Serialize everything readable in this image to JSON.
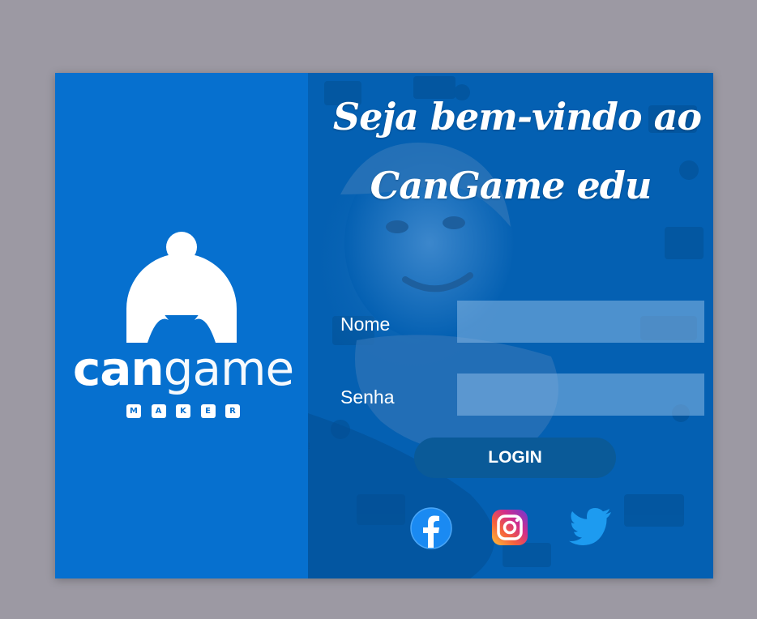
{
  "colors": {
    "page_background": "#9c99a3",
    "left_panel": "#0670cf",
    "right_panel": "#0460b2",
    "input_fill": "#8abae6",
    "login_button": "#0a5a98",
    "text": "#ffffff"
  },
  "logo": {
    "word_bold": "can",
    "word_light": "game",
    "maker_letters": [
      "M",
      "A",
      "K",
      "E",
      "R"
    ]
  },
  "welcome": {
    "line1": "Seja bem-vindo ao",
    "line2": "CanGame edu"
  },
  "form": {
    "name_label": "Nome",
    "name_value": "",
    "password_label": "Senha",
    "password_value": "",
    "login_label": "LOGIN"
  },
  "social": {
    "icons": [
      "facebook-icon",
      "instagram-icon",
      "twitter-icon"
    ]
  }
}
